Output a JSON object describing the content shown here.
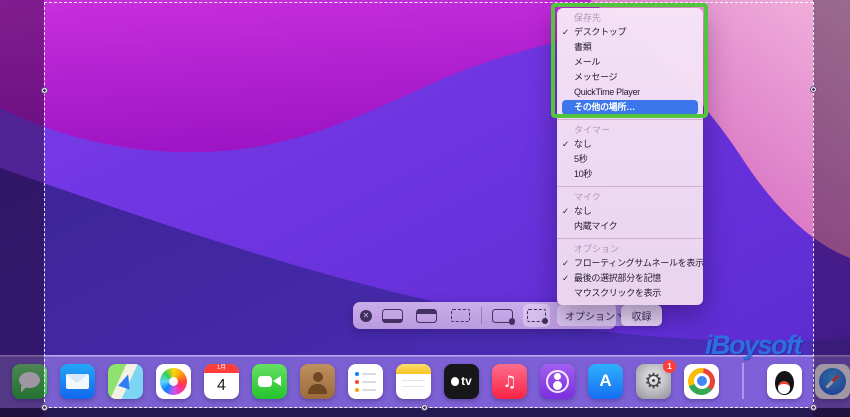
{
  "menu": {
    "check_glyph": "✓",
    "sections": [
      {
        "header": "保存先",
        "items": [
          {
            "label": "デスクトップ",
            "checked": true
          },
          {
            "label": "書類",
            "checked": false
          },
          {
            "label": "メール",
            "checked": false
          },
          {
            "label": "メッセージ",
            "checked": false
          },
          {
            "label": "QuickTime Player",
            "checked": false
          },
          {
            "label": "その他の場所…",
            "checked": false,
            "selected": true
          }
        ]
      },
      {
        "header": "タイマー",
        "items": [
          {
            "label": "なし",
            "checked": true
          },
          {
            "label": "5秒",
            "checked": false
          },
          {
            "label": "10秒",
            "checked": false
          }
        ]
      },
      {
        "header": "マイク",
        "items": [
          {
            "label": "なし",
            "checked": true
          },
          {
            "label": "内蔵マイク",
            "checked": false
          }
        ]
      },
      {
        "header": "オプション",
        "items": [
          {
            "label": "フローティングサムネールを表示",
            "checked": true
          },
          {
            "label": "最後の選択部分を記憶",
            "checked": true
          },
          {
            "label": "マウスクリックを表示",
            "checked": false
          }
        ]
      }
    ]
  },
  "toolbar": {
    "close_glyph": "✕",
    "options_label": "オプション",
    "record_label": "収録"
  },
  "dock": {
    "apps": [
      "messages",
      "mail",
      "maps",
      "photos",
      "calendar",
      "facetime",
      "contacts",
      "reminders",
      "notes",
      "appletv",
      "music",
      "podcasts",
      "appstore",
      "settings",
      "chrome",
      "divider",
      "qq",
      "safari"
    ],
    "calendar": {
      "month": "1月",
      "day": "4"
    },
    "appletv_label": "tv",
    "settings_badge": "1"
  },
  "watermark": "iBoysoft",
  "colors": {
    "menu_highlight_blue": "#3b76ea",
    "annotation_green": "#53c43c",
    "watermark_blue": "#2d6fe2",
    "selection_dash": "#ffffff"
  }
}
